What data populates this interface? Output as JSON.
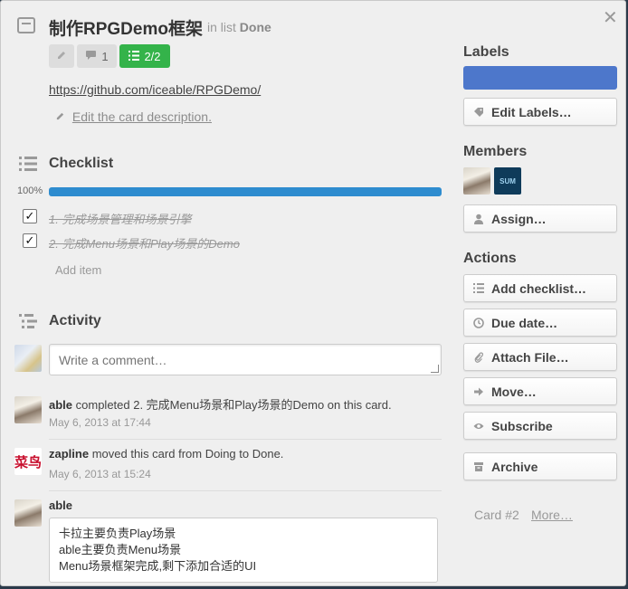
{
  "close_glyph": "✕",
  "card": {
    "title": "制作RPGDemo框架",
    "in_list_prefix": "in list",
    "list_name": "Done",
    "badges": {
      "comments": "1",
      "checklist": "2/2"
    },
    "link": "https://github.com/iceable/RPGDemo/",
    "edit_description": "Edit the card description."
  },
  "checklist": {
    "heading": "Checklist",
    "percent": "100%",
    "progress": 1.0,
    "items": [
      {
        "text": "1. 完成场景管理和场景引擎",
        "done": true
      },
      {
        "text": "2. 完成Menu场景和Play场景的Demo",
        "done": true
      }
    ],
    "add_item": "Add item"
  },
  "activity": {
    "heading": "Activity",
    "comment_placeholder": "Write a comment…",
    "entries": [
      {
        "user": "able",
        "action": "completed 2. 完成Menu场景和Play场景的Demo on this card.",
        "date": "May 6, 2013 at 17:44"
      },
      {
        "user": "zapline",
        "action": "moved this card from Doing to Done.",
        "date": "May 6, 2013 at 15:24",
        "avatar_text": "菜鸟"
      },
      {
        "user": "able",
        "comment_lines": [
          "卡拉主要负责Play场景",
          "able主要负责Menu场景",
          "Menu场景框架完成,剩下添加合适的UI"
        ]
      }
    ]
  },
  "sidebar": {
    "labels_heading": "Labels",
    "label_color": "#4d77cb",
    "edit_labels": "Edit Labels…",
    "members_heading": "Members",
    "member_badge_text": "SUM",
    "assign": "Assign…",
    "actions_heading": "Actions",
    "actions": [
      "Add checklist…",
      "Due date…",
      "Attach File…",
      "Move…",
      "Subscribe"
    ],
    "archive": "Archive",
    "card_number": "Card #2",
    "more": "More…"
  },
  "colors": {
    "accent_green": "#34b34a",
    "progress_blue": "#2e8ccf"
  }
}
